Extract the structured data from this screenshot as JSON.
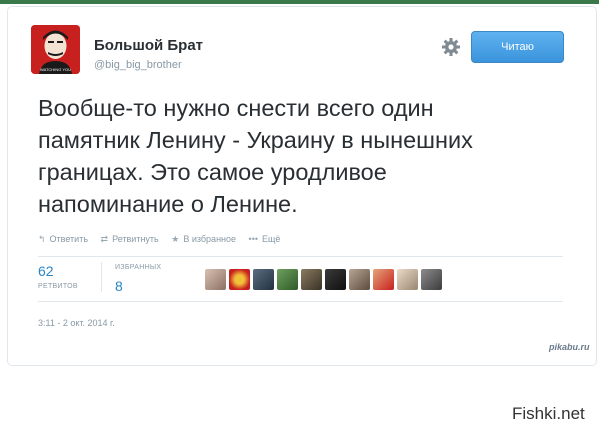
{
  "profile": {
    "name": "Большой Брат",
    "handle": "@big_big_brother",
    "avatar_caption": "WATCHING YOU"
  },
  "follow_button": {
    "label": "Читаю"
  },
  "icons": {
    "settings": "gear-icon",
    "reply": "reply-icon",
    "retweet": "retweet-icon",
    "favorite": "star-icon",
    "more": "more-icon"
  },
  "tweet": {
    "lines": [
      "Вообще-то нужно снести всего один",
      "памятник Ленину - Украину в нынешних",
      "границах. Это самое уродливое",
      "напоминание о Ленине."
    ]
  },
  "actions": {
    "reply": "Ответить",
    "retweet": "Ретвитнуть",
    "favorite": "В избранное",
    "more": "Ещё"
  },
  "stats": {
    "retweets_count": "62",
    "retweets_label": "РЕТВИТОВ",
    "favorites_label": "ИЗБРАННЫХ",
    "favorites_count": "8"
  },
  "timestamp": "3:11 - 2 окт. 2014 г.",
  "watermarks": {
    "pikabu": "pikabu.ru",
    "fishki": "Fishki.net"
  },
  "colors": {
    "accent": "#2a86c6",
    "follow_button": "#4aa3e6",
    "avatar_red": "#c8201f"
  }
}
